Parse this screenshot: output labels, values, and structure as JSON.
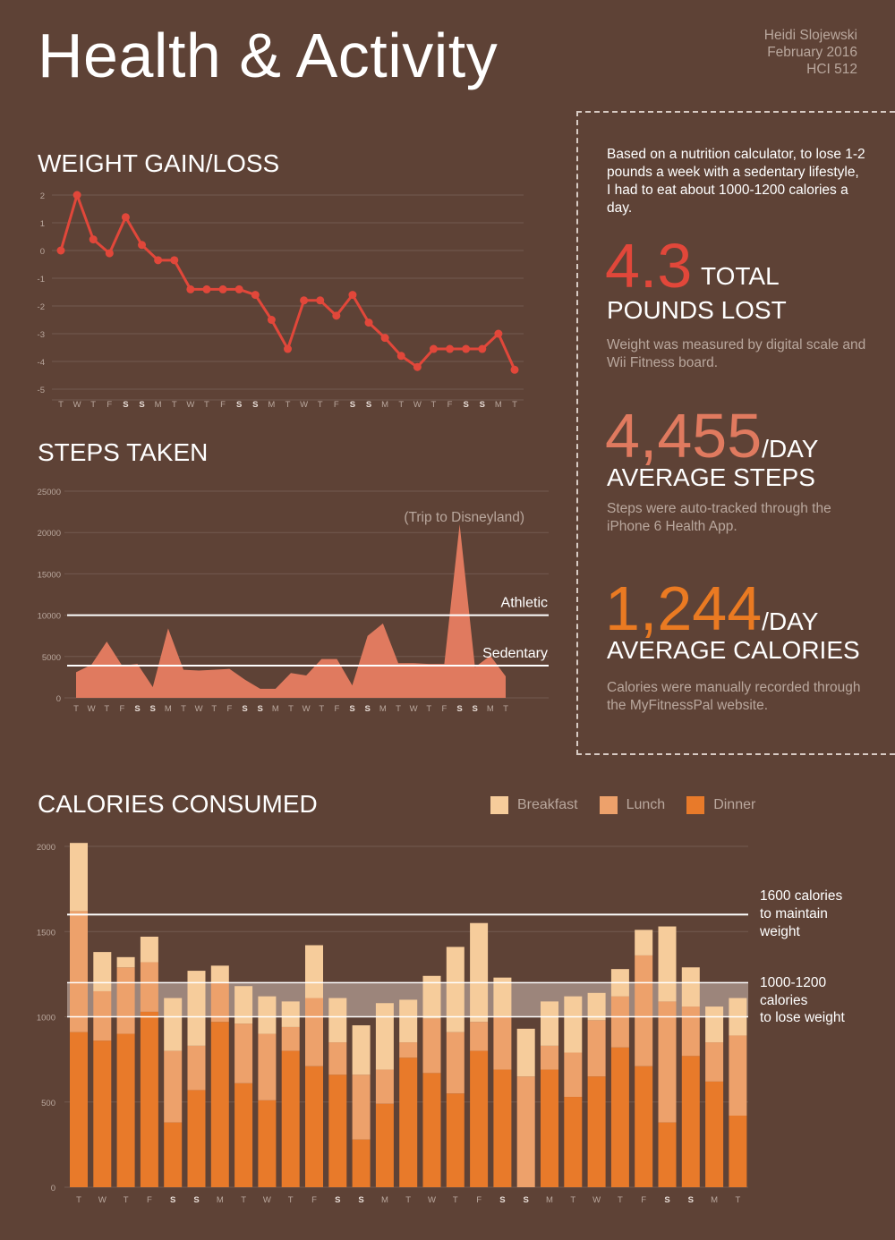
{
  "header": {
    "title": "Health & Activity",
    "author": "Heidi Slojewski",
    "date": "February 2016",
    "course": "HCI 512"
  },
  "infobox": {
    "intro": "Based on a nutrition calculator, to lose 1-2 pounds a week with a sedentary lifestyle, I had to eat about 1000-1200 calories a day.",
    "weight": {
      "value": "4.3",
      "label_a": "TOTAL",
      "label_b": "POUNDS LOST",
      "note": "Weight was measured by digital scale and Wii Fitness board."
    },
    "steps": {
      "value": "4,455",
      "suffix": "/DAY",
      "label": "AVERAGE STEPS",
      "note": "Steps were auto-tracked through the iPhone 6 Health App."
    },
    "calories": {
      "value": "1,244",
      "suffix": "/DAY",
      "label": "AVERAGE CALORIES",
      "note": "Calories were manually recorded through the MyFitnessPal website."
    }
  },
  "colors": {
    "background": "#5e4236",
    "weight_line": "#e1473a",
    "steps_fill": "#e07a5f",
    "breakfast": "#f6cc9b",
    "lunch": "#eda16b",
    "dinner": "#e87a2a",
    "stat_weight": "#e1473a",
    "stat_steps": "#e07a5f",
    "stat_calories": "#ea7a22"
  },
  "chart_data": [
    {
      "id": "weight",
      "type": "line",
      "title": "WEIGHT GAIN/LOSS",
      "x": [
        "T",
        "W",
        "T",
        "F",
        "S",
        "S",
        "M",
        "T",
        "W",
        "T",
        "F",
        "S",
        "S",
        "M",
        "T",
        "W",
        "T",
        "F",
        "S",
        "S",
        "M",
        "T",
        "W",
        "T",
        "F",
        "S",
        "S",
        "M",
        "T"
      ],
      "bold_x": [
        4,
        5,
        11,
        12,
        18,
        19,
        25,
        26
      ],
      "values": [
        0,
        2,
        0.4,
        -0.1,
        1.2,
        0.2,
        -0.35,
        -0.35,
        -1.4,
        -1.4,
        -1.4,
        -1.4,
        -1.6,
        -2.5,
        -3.55,
        -1.8,
        -1.8,
        -2.35,
        -1.6,
        -2.6,
        -3.15,
        -3.8,
        -4.2,
        -3.55,
        -3.55,
        -3.55,
        -3.55,
        -3.0,
        -4.3
      ],
      "ylim": [
        -5,
        2
      ],
      "yticks": [
        "2",
        "1",
        "0",
        "-1",
        "-2",
        "-3",
        "-4",
        "-5"
      ],
      "grid": true
    },
    {
      "id": "steps",
      "type": "area",
      "title": "STEPS TAKEN",
      "x": [
        "T",
        "W",
        "T",
        "F",
        "S",
        "S",
        "M",
        "T",
        "W",
        "T",
        "F",
        "S",
        "S",
        "M",
        "T",
        "W",
        "T",
        "F",
        "S",
        "S",
        "M",
        "T",
        "W",
        "T",
        "F",
        "S",
        "S",
        "M",
        "T"
      ],
      "bold_x": [
        4,
        5,
        11,
        12,
        18,
        19,
        25,
        26
      ],
      "values": [
        3100,
        4000,
        6800,
        3900,
        4100,
        1300,
        8400,
        3400,
        3300,
        3400,
        3500,
        2200,
        1100,
        1100,
        3000,
        2700,
        4700,
        4700,
        1500,
        7500,
        9000,
        4200,
        4200,
        4100,
        4100,
        21000,
        3700,
        5100,
        2600
      ],
      "ylim": [
        0,
        25000
      ],
      "yticks": [
        "0",
        "5000",
        "10000",
        "15000",
        "20000",
        "25000"
      ],
      "reference_lines": [
        {
          "label": "Athletic",
          "value": 10000
        },
        {
          "label": "Sedentary",
          "value": 3900
        }
      ],
      "annotation": "(Trip to Disneyland)",
      "grid": true
    },
    {
      "id": "calories",
      "type": "bar",
      "title": "CALORIES CONSUMED",
      "stacked": true,
      "categories": [
        "T",
        "W",
        "T",
        "F",
        "S",
        "S",
        "M",
        "T",
        "W",
        "T",
        "F",
        "S",
        "S",
        "M",
        "T",
        "W",
        "T",
        "F",
        "S",
        "S",
        "M",
        "T",
        "W",
        "T",
        "F",
        "S",
        "S",
        "M",
        "T"
      ],
      "bold_x": [
        4,
        5,
        11,
        12,
        18,
        19,
        25,
        26
      ],
      "series": [
        {
          "name": "Dinner",
          "values": [
            910,
            860,
            900,
            1030,
            380,
            570,
            970,
            610,
            510,
            800,
            710,
            660,
            280,
            490,
            760,
            670,
            550,
            800,
            690,
            0,
            690,
            530,
            650,
            820,
            710,
            380,
            770,
            620,
            420
          ]
        },
        {
          "name": "Lunch",
          "values": [
            710,
            290,
            390,
            290,
            420,
            260,
            230,
            350,
            390,
            140,
            400,
            190,
            380,
            200,
            90,
            320,
            360,
            170,
            310,
            650,
            140,
            260,
            330,
            300,
            650,
            710,
            290,
            230,
            470
          ]
        },
        {
          "name": "Breakfast",
          "values": [
            400,
            230,
            60,
            150,
            310,
            440,
            100,
            220,
            220,
            150,
            310,
            260,
            290,
            390,
            250,
            250,
            500,
            580,
            230,
            280,
            260,
            330,
            160,
            160,
            150,
            440,
            230,
            210,
            220
          ]
        }
      ],
      "ylim": [
        0,
        2000
      ],
      "yticks": [
        "0",
        "500",
        "1000",
        "1500",
        "2000"
      ],
      "reference_lines": [
        {
          "label": "1600 calories to maintain weight",
          "value": 1600
        }
      ],
      "reference_band": {
        "label": "1000-1200 calories to lose weight",
        "from": 1000,
        "to": 1200
      },
      "legend": [
        "Breakfast",
        "Lunch",
        "Dinner"
      ],
      "legend_position": "top-right",
      "grid": true
    }
  ],
  "labels": {
    "athletic": "Athletic",
    "sedentary": "Sedentary",
    "disney": "(Trip to Disneyland)",
    "maintain_1": "1600 calories",
    "maintain_2": "to maintain",
    "maintain_3": "weight",
    "lose_1": "1000-1200",
    "lose_2": "calories",
    "lose_3": "to lose weight"
  }
}
